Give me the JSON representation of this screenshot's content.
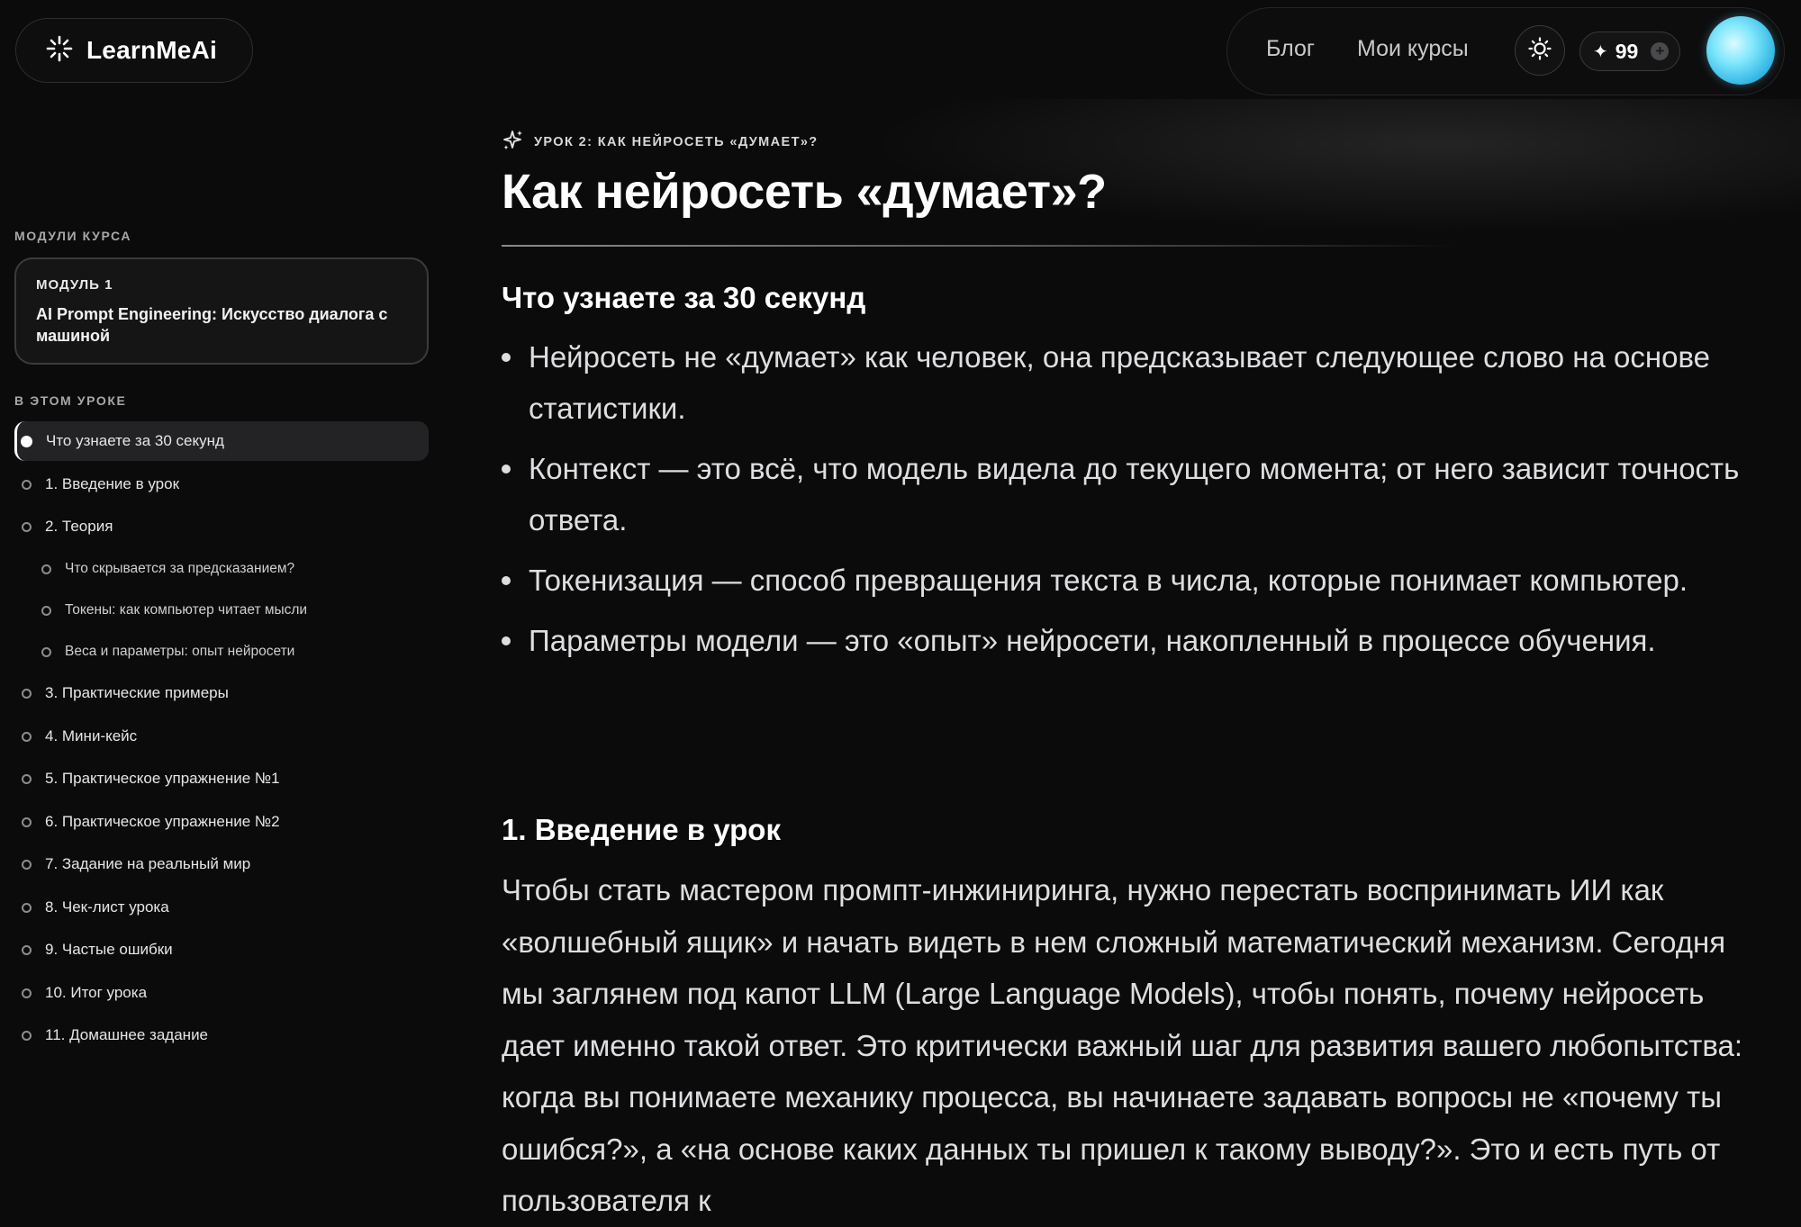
{
  "brand": {
    "name": "LearnMeAi",
    "logo_icon": "sparkle-burst-icon"
  },
  "nav": {
    "links": [
      "Блог",
      "Мои курсы"
    ],
    "theme_icon": "sun-icon",
    "credits": {
      "star": "✦",
      "value": "99",
      "plus": "+"
    },
    "avatar_icon": "avatar-orb"
  },
  "sidebar": {
    "modules_label": "МОДУЛИ КУРСА",
    "module": {
      "number": "МОДУЛЬ 1",
      "title": "AI Prompt Engineering: Искусство диалога с машиной"
    },
    "lesson_label": "В ЭТОМ УРОКЕ",
    "items": [
      {
        "label": "Что узнаете за 30 секунд",
        "active": true,
        "sub": false
      },
      {
        "label": "1. Введение в урок",
        "active": false,
        "sub": false
      },
      {
        "label": "2. Теория",
        "active": false,
        "sub": false
      },
      {
        "label": "Что скрывается за предсказанием?",
        "active": false,
        "sub": true
      },
      {
        "label": "Токены: как компьютер читает мысли",
        "active": false,
        "sub": true
      },
      {
        "label": "Веса и параметры: опыт нейросети",
        "active": false,
        "sub": true
      },
      {
        "label": "3. Практические примеры",
        "active": false,
        "sub": false
      },
      {
        "label": "4. Мини-кейс",
        "active": false,
        "sub": false
      },
      {
        "label": "5. Практическое упражнение №1",
        "active": false,
        "sub": false
      },
      {
        "label": "6. Практическое упражнение №2",
        "active": false,
        "sub": false
      },
      {
        "label": "7. Задание на реальный мир",
        "active": false,
        "sub": false
      },
      {
        "label": "8. Чек-лист урока",
        "active": false,
        "sub": false
      },
      {
        "label": "9. Частые ошибки",
        "active": false,
        "sub": false
      },
      {
        "label": "10. Итог урока",
        "active": false,
        "sub": false
      },
      {
        "label": "11. Домашнее задание",
        "active": false,
        "sub": false
      }
    ]
  },
  "main": {
    "breadcrumb": "УРОК 2: КАК НЕЙРОСЕТЬ «ДУМАЕТ»?",
    "breadcrumb_icon": "sparkles-icon",
    "title": "Как нейросеть «думает»?",
    "summary_heading": "Что узнаете за 30 секунд",
    "bullets": [
      "Нейросеть не «думает» как человек, она предсказывает следующее слово на основе статистики.",
      "Контекст — это всё, что модель видела до текущего момента; от него зависит точность ответа.",
      "Токенизация — способ превращения текста в числа, которые понимает компьютер.",
      "Параметры модели — это «опыт» нейросети, накопленный в процессе обучения."
    ],
    "intro_heading": "1. Введение в урок",
    "intro_text": "Чтобы стать мастером промпт-инжиниринга, нужно перестать воспринимать ИИ как «волшебный ящик» и начать видеть в нем сложный математический механизм. Сегодня мы заглянем под капот LLM (Large Language Models), чтобы понять, почему нейросеть дает именно такой ответ. Это критически важный шаг для развития вашего любопытства: когда вы понимаете механику процесса, вы начинаете задавать вопросы не «почему ты ошибся?», а «на основе каких данных ты пришел к такому выводу?». Это и есть путь от пользователя к"
  }
}
